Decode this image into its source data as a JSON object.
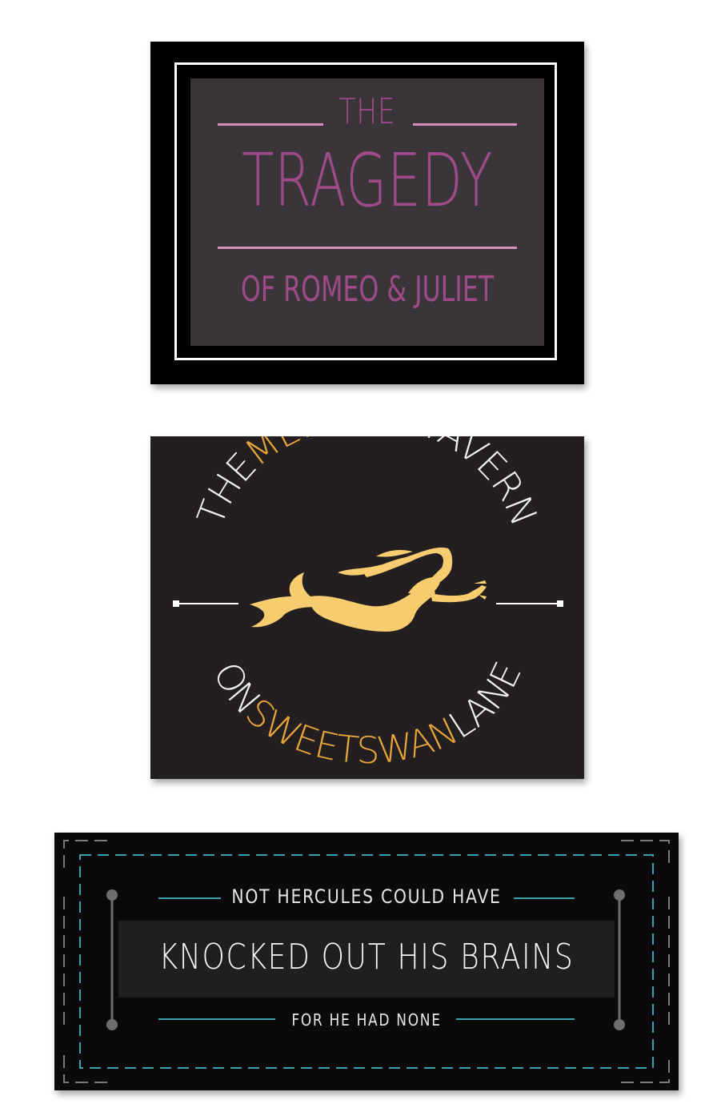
{
  "cards": [
    {
      "the": "THE",
      "title": "TRAGEDY",
      "subtitle": "OF ROMEO & JULIET",
      "colors": {
        "text": "#9f4a89",
        "rule": "#d88fc0",
        "panel": "#3a3538"
      }
    },
    {
      "arc_top": [
        {
          "text": "THE",
          "tone": "white"
        },
        {
          "text": "MERMAID",
          "tone": "gold"
        },
        {
          "text": "TAVERN",
          "tone": "white"
        }
      ],
      "arc_bottom": [
        {
          "text": "ON",
          "tone": "white"
        },
        {
          "text": "SWEETSWAN",
          "tone": "gold"
        },
        {
          "text": "LANE",
          "tone": "white"
        }
      ],
      "icon": "mermaid-silhouette",
      "colors": {
        "gold": "#e8a53a",
        "white": "#f2f2f2",
        "mermaid": "#f7cd6f",
        "bg": "#231f20"
      }
    },
    {
      "top": "NOT HERCULES COULD HAVE",
      "main": "KNOCKED OUT HIS BRAINS",
      "bottom": "FOR HE HAD NONE",
      "colors": {
        "rule": "#3aa0b0",
        "dash": "#7a7a7a",
        "band": "#1f1f1f"
      }
    }
  ]
}
